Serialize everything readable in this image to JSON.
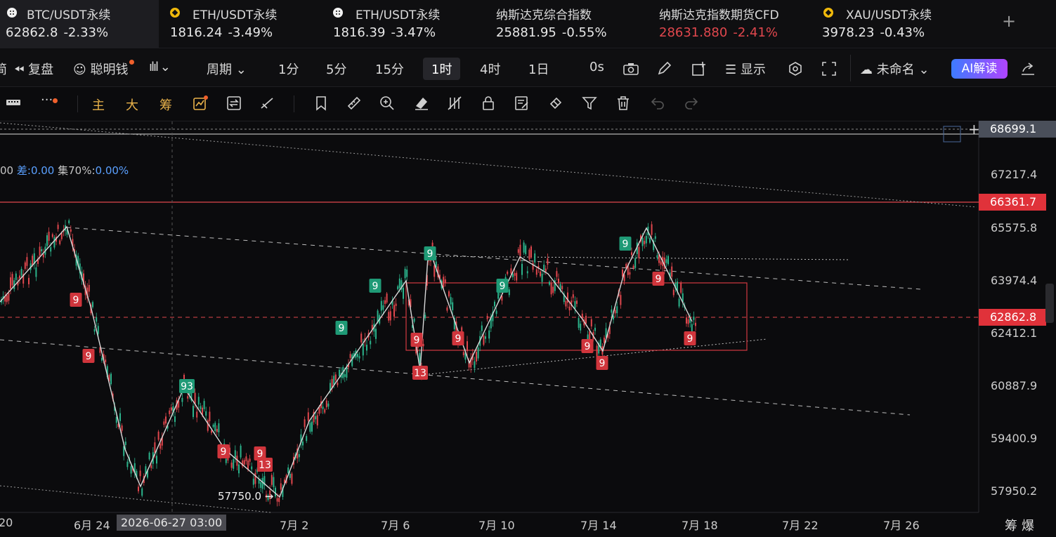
{
  "ticker": [
    {
      "name": "BTC/USDT永续",
      "price": "62862.8",
      "change": "-2.33%",
      "icon": "btc-coin-icon",
      "active": true,
      "red": false
    },
    {
      "name": "ETH/USDT永续",
      "price": "1816.24",
      "change": "-3.49%",
      "icon": "bnb-coin-icon",
      "active": false,
      "red": false
    },
    {
      "name": "ETH/USDT永续",
      "price": "1816.39",
      "change": "-3.47%",
      "icon": "btc-coin-icon",
      "active": false,
      "red": false
    },
    {
      "name": "纳斯达克综合指数",
      "price": "25881.95",
      "change": "-0.55%",
      "icon": "",
      "active": false,
      "red": false
    },
    {
      "name": "纳斯达克指数期货CFD",
      "price": "28631.880",
      "change": "-2.41%",
      "icon": "",
      "active": false,
      "red": true
    },
    {
      "name": "XAU/USDT永续",
      "price": "3978.23",
      "change": "-0.43%",
      "icon": "bnb-coin-icon",
      "active": false,
      "red": false
    }
  ],
  "ticker_add": "+",
  "toolbar": {
    "left_cut": "简",
    "replay": "复盘",
    "smart_money": "聪明钱",
    "period": "周期",
    "intervals": [
      "1分",
      "5分",
      "15分",
      "1时",
      "4时",
      "1日"
    ],
    "selected_interval": "1时",
    "countdown": "0s",
    "display": "显示",
    "layout_name": "未命名",
    "ai_button": "AI解读"
  },
  "toolbar2": {
    "more": "···",
    "main": "主",
    "big": "大",
    "chips": "筹"
  },
  "chart": {
    "info_prefix": "00",
    "info_diff_label": "差:",
    "info_diff": "0.00",
    "info_conc_label": "集70%:",
    "info_conc": "0.00%",
    "price_axis": [
      "68699.1",
      "67217.4",
      "66361.7",
      "65575.8",
      "63974.4",
      "62862.8",
      "62412.1",
      "60887.9",
      "59400.9",
      "57950.2"
    ],
    "current_price": "62862.8",
    "alert_price": "66361.7",
    "top_price": "68699.1",
    "x_axis": [
      "20",
      "6月 24",
      "7月 2",
      "7月 6",
      "7月 10",
      "7月 14",
      "7月 18",
      "7月 22",
      "7月 26"
    ],
    "cursor_date": "2026-06-27 03:00",
    "low_label": "57750.0 →",
    "bottom_right": "筹爆",
    "td_labels": [
      {
        "text": "9",
        "color": "red"
      },
      {
        "text": "9",
        "color": "red"
      },
      {
        "text": "93",
        "color": "green"
      },
      {
        "text": "9",
        "color": "red"
      },
      {
        "text": "9",
        "color": "red"
      },
      {
        "text": "13",
        "color": "red"
      },
      {
        "text": "9",
        "color": "green"
      },
      {
        "text": "9",
        "color": "green"
      },
      {
        "text": "9",
        "color": "green"
      },
      {
        "text": "9",
        "color": "red"
      },
      {
        "text": "13",
        "color": "red"
      },
      {
        "text": "9",
        "color": "red"
      },
      {
        "text": "9",
        "color": "green"
      },
      {
        "text": "9",
        "color": "red"
      },
      {
        "text": "9",
        "color": "red"
      },
      {
        "text": "9",
        "color": "green"
      },
      {
        "text": "9",
        "color": "red"
      },
      {
        "text": "9",
        "color": "red"
      }
    ]
  },
  "colors": {
    "up": "#2bb38b",
    "down": "#e0474d",
    "accent": "#e9b24a",
    "ai_start": "#3d7bff",
    "ai_end": "#b044ff"
  }
}
